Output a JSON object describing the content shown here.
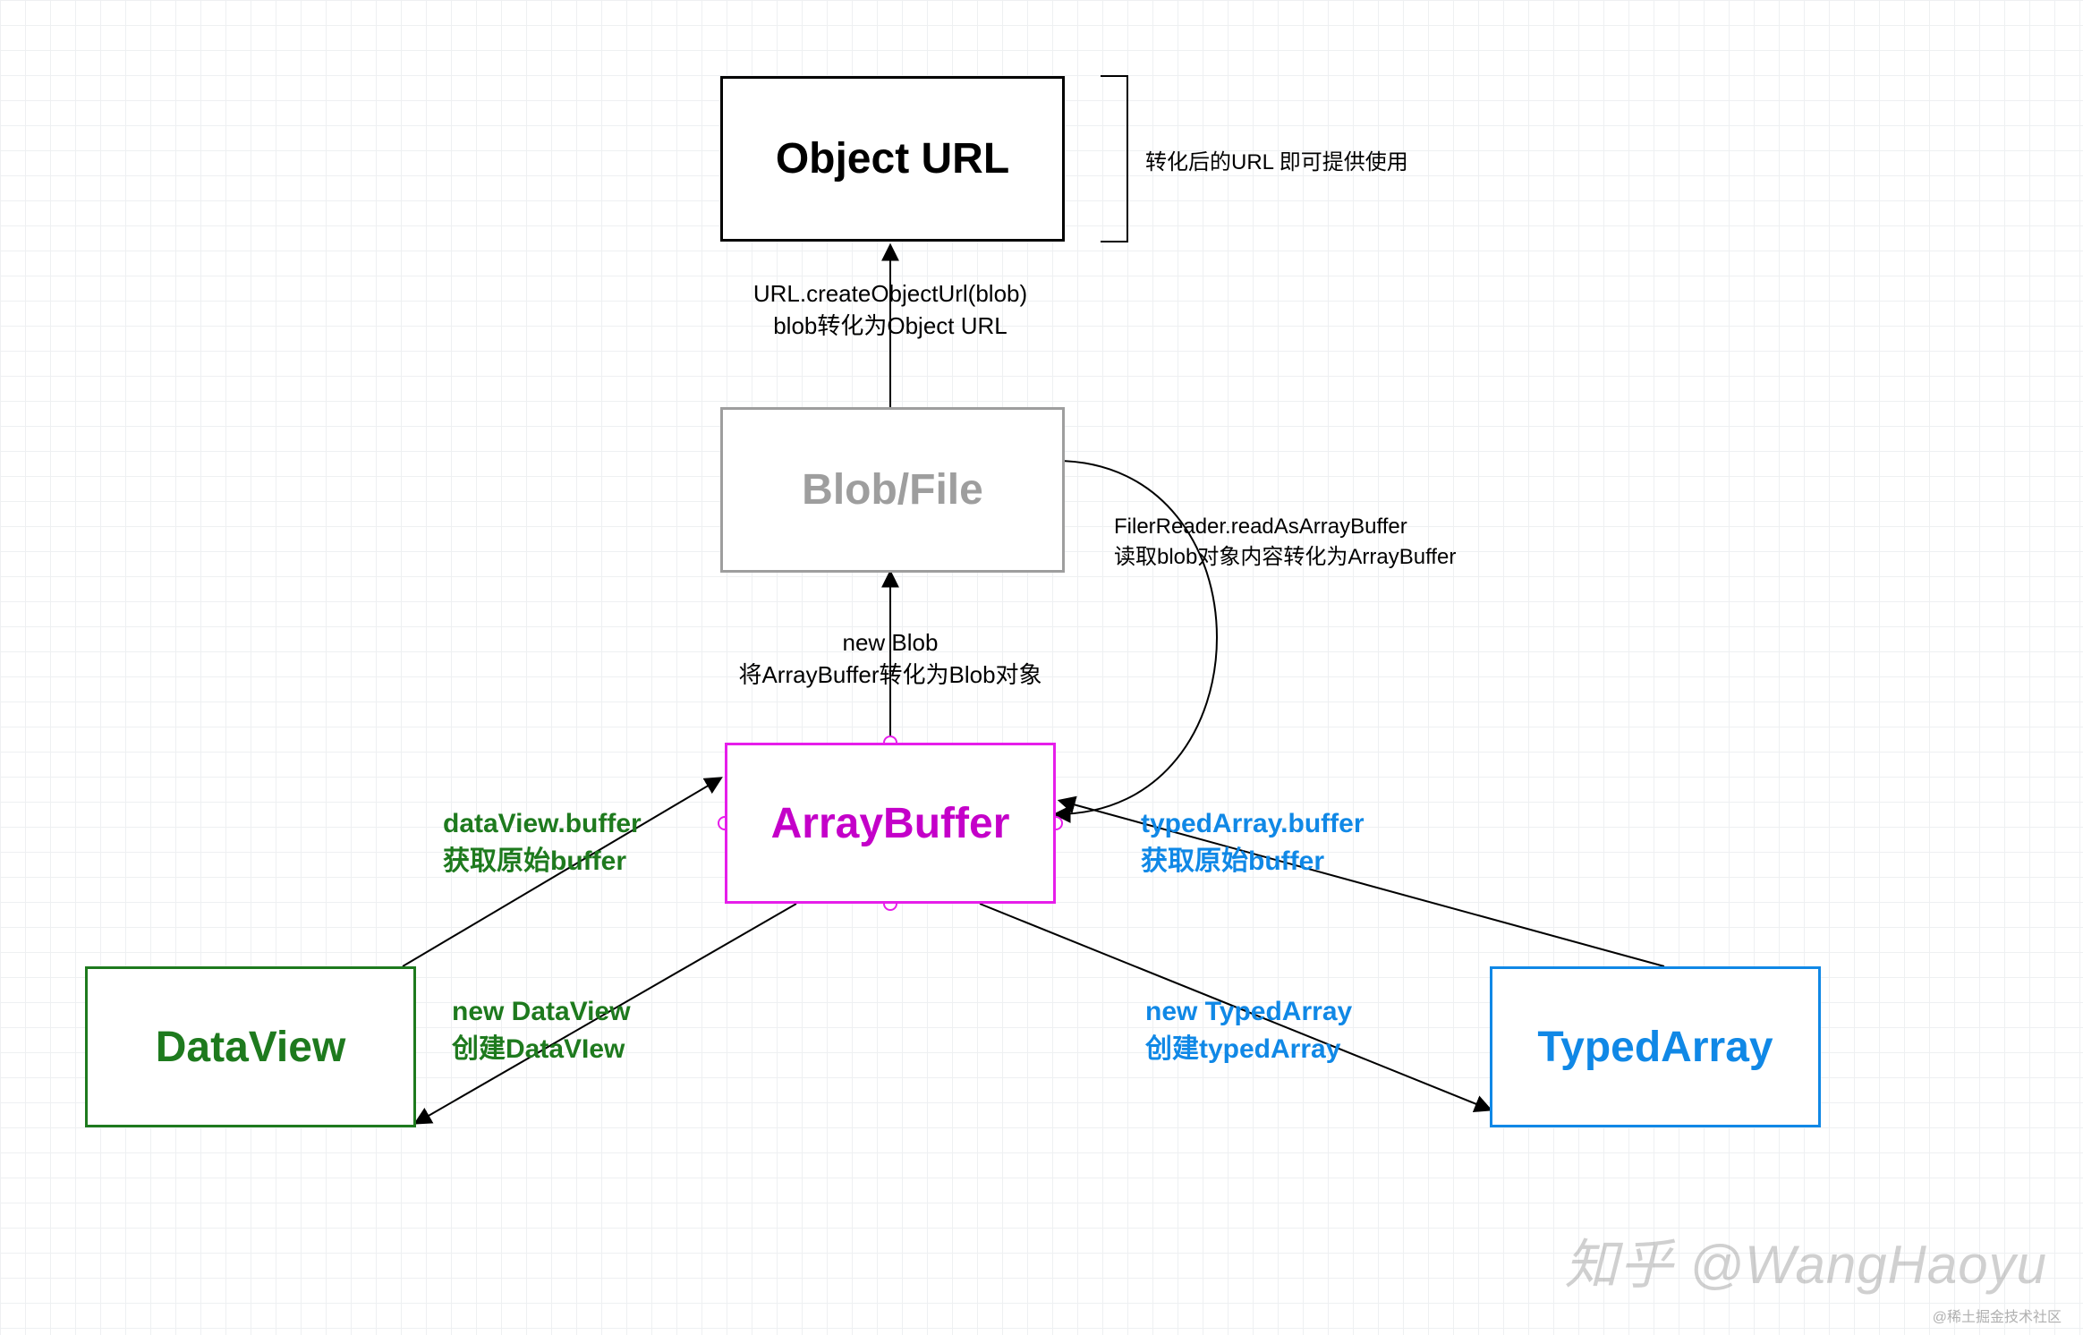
{
  "nodes": {
    "objectUrl": {
      "label": "Object URL",
      "color": "#000000",
      "border": "#000000"
    },
    "blobFile": {
      "label": "Blob/File",
      "color": "#9e9e9e",
      "border": "#9e9e9e"
    },
    "arrayBuffer": {
      "label": "ArrayBuffer",
      "color": "#c400c9",
      "border": "#e61eea"
    },
    "dataView": {
      "label": "DataView",
      "color": "#1e7a1e",
      "border": "#1e7a1e"
    },
    "typedArray": {
      "label": "TypedArray",
      "color": "#1088e6",
      "border": "#1088e6"
    }
  },
  "labels": {
    "objectUrlNote": "转化后的URL 即可提供使用",
    "urlCreate1": "URL.createObjectUrl(blob)",
    "urlCreate2": "blob转化为Object URL",
    "fileReader1": "FilerReader.readAsArrayBuffer",
    "fileReader2": "读取blob对象内容转化为ArrayBuffer",
    "newBlob1": "new Blob",
    "newBlob2": "将ArrayBuffer转化为Blob对象",
    "dvBuffer1": "dataView.buffer",
    "dvBuffer2": "获取原始buffer",
    "newDv1": "new DataView",
    "newDv2": "创建DataVIew",
    "taBuffer1": "typedArray.buffer",
    "taBuffer2": "获取原始buffer",
    "newTa1": "new TypedArray",
    "newTa2": "创建typedArray"
  },
  "watermark": "知乎 @WangHaoyu",
  "footer": "@稀土掘金技术社区",
  "colors": {
    "green": "#1e7a1e",
    "blue": "#1088e6",
    "magenta": "#e61eea",
    "gray": "#9e9e9e",
    "black": "#000000"
  }
}
